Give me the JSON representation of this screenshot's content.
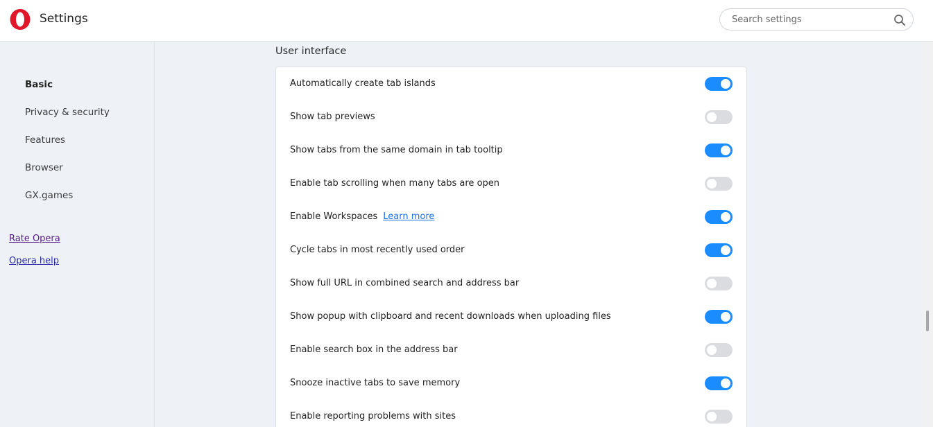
{
  "header": {
    "title": "Settings",
    "logo_icon": "opera-logo-icon",
    "search_placeholder": "Search settings",
    "search_icon": "search-icon"
  },
  "sidebar": {
    "items": [
      {
        "label": "Basic",
        "active": true
      },
      {
        "label": "Privacy & security",
        "active": false
      },
      {
        "label": "Features",
        "active": false
      },
      {
        "label": "Browser",
        "active": false
      },
      {
        "label": "GX.games",
        "active": false
      }
    ],
    "links": [
      {
        "label": "Rate Opera"
      },
      {
        "label": "Opera help"
      }
    ]
  },
  "main": {
    "section_title": "User interface",
    "settings": [
      {
        "label": "Automatically create tab islands",
        "enabled": true
      },
      {
        "label": "Show tab previews",
        "enabled": false
      },
      {
        "label": "Show tabs from the same domain in tab tooltip",
        "enabled": true
      },
      {
        "label": "Enable tab scrolling when many tabs are open",
        "enabled": false
      },
      {
        "label": "Enable Workspaces",
        "link": "Learn more",
        "enabled": true
      },
      {
        "label": "Cycle tabs in most recently used order",
        "enabled": true
      },
      {
        "label": "Show full URL in combined search and address bar",
        "enabled": false
      },
      {
        "label": "Show popup with clipboard and recent downloads when uploading files",
        "enabled": true
      },
      {
        "label": "Enable search box in the address bar",
        "enabled": false
      },
      {
        "label": "Snooze inactive tabs to save memory",
        "enabled": true
      },
      {
        "label": "Enable reporting problems with sites",
        "enabled": false
      }
    ]
  },
  "colors": {
    "toggle_on": "#1a8cff",
    "toggle_off": "#dadce0",
    "brand_red": "#e0162b",
    "link": "#1a73e8"
  }
}
